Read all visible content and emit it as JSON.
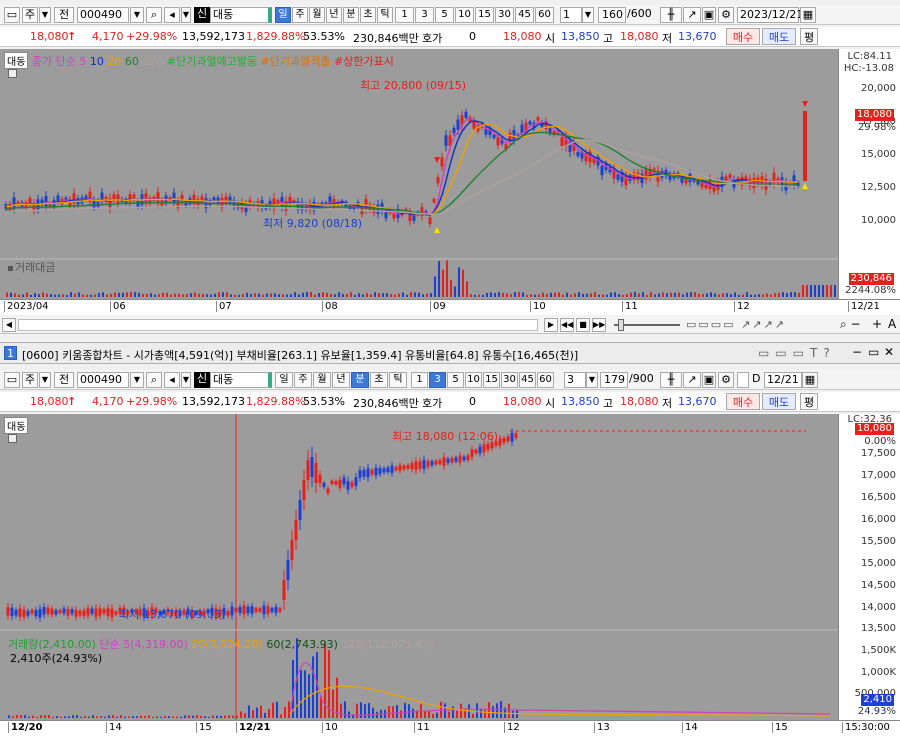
{
  "top": {
    "toolbar": {
      "code": "000490",
      "name": "대동",
      "mode_badge": "신",
      "periods": [
        "일",
        "주",
        "월",
        "년",
        "분",
        "초",
        "틱"
      ],
      "active_period": "일",
      "nums": [
        "1",
        "3",
        "5",
        "10",
        "15",
        "30",
        "45",
        "60"
      ],
      "sel_num": "1",
      "count": "160",
      "total": "/600",
      "date": "2023/12/21",
      "prefix1": "주",
      "prefix2": "전"
    },
    "quote": {
      "price": "18,080",
      "arrow": "↑",
      "change": "4,170",
      "rate": "+29.98%",
      "volume": "13,592,173",
      "vol_rate": "1,829.88%",
      "ratio": "53.53%",
      "amount": "230,846백만",
      "hoga_label": "호가",
      "hoga_val": "0",
      "ask": "18,080",
      "open_label": "시",
      "open": "13,850",
      "high_label": "고",
      "high": "18,080",
      "low_label": "저",
      "low": "13,670",
      "buy": "매수",
      "sell": "매도",
      "avg": "평"
    },
    "legend": {
      "stock": "대동",
      "series": [
        "종가 단순 5",
        "10",
        "20",
        "60",
        "120"
      ],
      "ind1": "#단기과열예고발동",
      "ind2": "#단기과열적출",
      "ind3": "#상한가표시"
    },
    "axis_ticks": [
      "20,000",
      "17,500",
      "15,000",
      "12,500",
      "10,000"
    ],
    "lc": "LC:84.11",
    "hc": "HC:-13.08",
    "price_label": "18,080",
    "price_pct": "29.98%",
    "high_annot": "최고 20,800 (09/15)",
    "low_annot": "최저 9,820 (08/18)",
    "vol_title": "거래대금",
    "vol_val": "230,846",
    "vol_pct": "2244.08%",
    "dates": [
      "2023/04",
      "06",
      "07",
      "08",
      "09",
      "10",
      "11",
      "12",
      "12/21"
    ]
  },
  "window": {
    "num": "1",
    "title": "[0600] 키움종합차트 - 시가총액[4,591(억)] 부채비율[263.1] 유보율[1,359.4] 유통비율[64.8] 유통수[16,465(천)]"
  },
  "bottom": {
    "toolbar": {
      "code": "000490",
      "name": "대동",
      "mode_badge": "신",
      "periods": [
        "일",
        "주",
        "월",
        "년",
        "분",
        "초",
        "틱"
      ],
      "active_period": "분",
      "nums": [
        "1",
        "3",
        "5",
        "10",
        "15",
        "30",
        "45",
        "60"
      ],
      "active_num": "3",
      "sel_num": "3",
      "count": "179",
      "total": "/900",
      "date": "12/21",
      "prefix1": "주",
      "prefix2": "전",
      "d": "D"
    },
    "quote": {
      "price": "18,080",
      "arrow": "↑",
      "change": "4,170",
      "rate": "+29.98%",
      "volume": "13,592,173",
      "vol_rate": "1,829.88%",
      "ratio": "53.53%",
      "amount": "230,846백만",
      "hoga_label": "호가",
      "hoga_val": "0",
      "ask": "18,080",
      "open_label": "시",
      "open": "13,850",
      "high_label": "고",
      "high": "18,080",
      "low_label": "저",
      "low": "13,670",
      "buy": "매수",
      "sell": "매도",
      "avg": "평"
    },
    "legend": {
      "stock": "대동"
    },
    "axis_ticks": [
      "17,500",
      "17,000",
      "16,500",
      "16,000",
      "15,500",
      "15,000",
      "14,500",
      "14,000",
      "13,500"
    ],
    "lc": "LC:32.36",
    "price_label": "18,080",
    "price_pct": "0.00%",
    "high_annot": "최고 18,080 (12:06)",
    "low_annot": "최저 13,670 (09:03)",
    "vol_legend": {
      "v": "거래량(2,410.00)",
      "a": "단순 5(4,319.00)",
      "b": "20(3,824.20)",
      "c": "60(2,743.93)",
      "d": "120(112,671.63)"
    },
    "vol_sub": "2,410주(24.93%)",
    "vol_ticks": [
      "1,500K",
      "1,000K",
      "500,000"
    ],
    "vol_val": "2,410",
    "vol_pct": "24.93%",
    "dates": [
      "12/20",
      "14",
      "15",
      "12/21",
      "10",
      "11",
      "12",
      "13",
      "14",
      "15",
      "15:30:00"
    ]
  },
  "colors": {
    "up": "#e8201c",
    "down": "#1d40d0",
    "bg": "#9c9c9c"
  }
}
